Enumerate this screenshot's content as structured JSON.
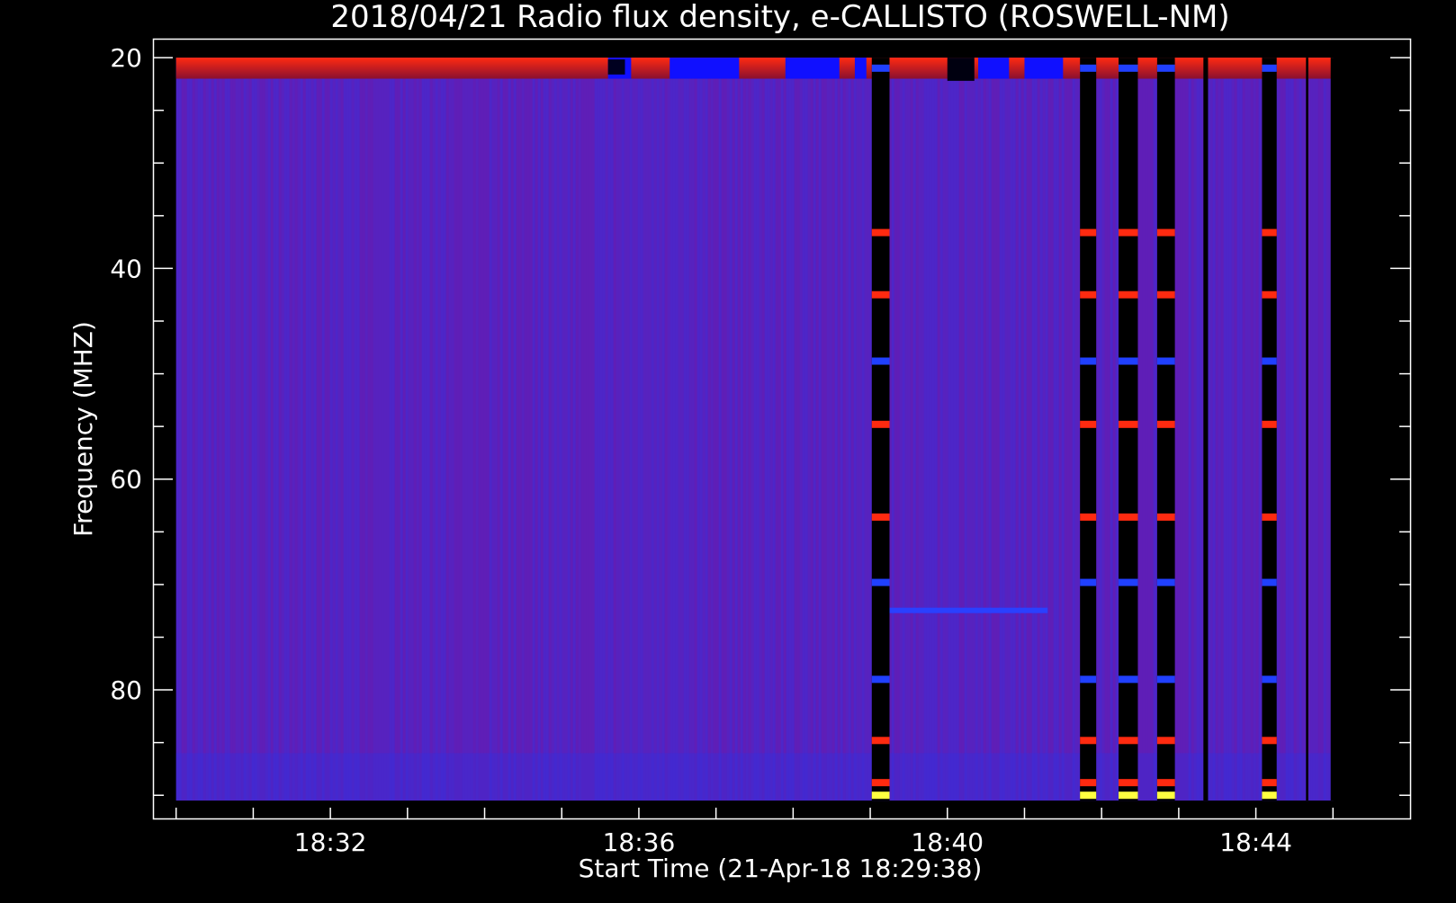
{
  "chart_data": {
    "type": "heatmap",
    "title": "2018/04/21  Radio flux density, e-CALLISTO (ROSWELL-NM)",
    "xlabel": "Start Time (21-Apr-18 18:29:38)",
    "ylabel": "Frequency (MHZ)",
    "x_ticks": [
      "18:32",
      "18:36",
      "18:40",
      "18:44"
    ],
    "y_ticks": [
      "20",
      "40",
      "60",
      "80"
    ],
    "x_range_minutes_after_start": [
      -0.3,
      16.0
    ],
    "data_time_range_minutes_after_start": [
      0.0,
      15.0
    ],
    "y_range_mhz": [
      18.2,
      92.2
    ],
    "data_freq_range_mhz": [
      20,
      90.5
    ],
    "y_inverted": true,
    "grid": false,
    "colormap": [
      "#000000",
      "#1010ff",
      "#5a20c8",
      "#b01010",
      "#ff3000",
      "#ff9040",
      "#ffff40"
    ],
    "background_color": "#5524bf",
    "gaps_minutes_after_start": [
      [
        9.02,
        9.25
      ],
      [
        11.72,
        11.93
      ],
      [
        12.22,
        12.47
      ],
      [
        12.72,
        12.95
      ],
      [
        13.32,
        13.38
      ],
      [
        14.08,
        14.27
      ],
      [
        14.65,
        14.68
      ]
    ],
    "rfi_bands_mhz": [
      {
        "freq": 21.0,
        "level": "low"
      },
      {
        "freq": 36.6,
        "level": "high"
      },
      {
        "freq": 42.5,
        "level": "high"
      },
      {
        "freq": 48.8,
        "level": "low"
      },
      {
        "freq": 54.8,
        "level": "high"
      },
      {
        "freq": 63.6,
        "level": "high"
      },
      {
        "freq": 69.8,
        "level": "low"
      },
      {
        "freq": 79.0,
        "level": "low"
      },
      {
        "freq": 84.8,
        "level": "high"
      },
      {
        "freq": 88.8,
        "level": "high"
      },
      {
        "freq": 90.0,
        "level": "max"
      }
    ]
  }
}
